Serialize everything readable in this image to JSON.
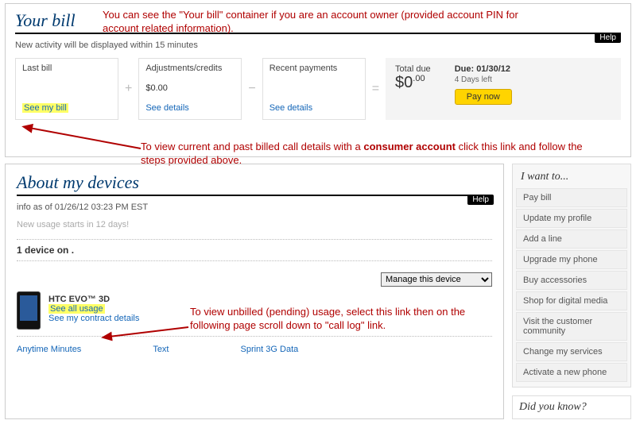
{
  "yourBill": {
    "title": "Your bill",
    "help": "Help",
    "newActivity": "New activity will be displayed within 15 minutes",
    "lastBill": {
      "label": "Last bill",
      "seeMyBill": "See my bill"
    },
    "adjustments": {
      "label": "Adjustments/credits",
      "amount": "$0.00",
      "seeDetails": "See details"
    },
    "recentPayments": {
      "label": "Recent payments",
      "seeDetails": "See details"
    },
    "totalDue": {
      "label": "Total due",
      "amount": "$0",
      "cents": ".00",
      "dueLabel": "Due: 01/30/12",
      "daysLeft": "4 Days left",
      "payNow": "Pay now"
    }
  },
  "annot": {
    "top": "You can see the \"Your bill\" container if you are an account owner (provided account PIN for account related information).",
    "mid1": "To view current and past billed call details with a ",
    "mid2": "consumer account",
    "mid3": " click this link and follow the steps provided above.",
    "bottom": "To view unbilled (pending) usage, select this link then on the following page scroll down to \"call log\" link."
  },
  "aboutDevices": {
    "title": "About my devices",
    "help": "Help",
    "infoAsOf": "info as of 01/26/12 03:23 PM EST",
    "newUsage": "New usage starts in 12 days!",
    "deviceCount": "1 device on .",
    "manageOption": "Manage this device",
    "device": {
      "name": "HTC EVO™ 3D",
      "seeAllUsage": "See all usage",
      "seeContract": "See my contract details"
    },
    "usageTabs": {
      "anytime": "Anytime Minutes",
      "text": "Text",
      "data": "Sprint 3G Data"
    }
  },
  "iWant": {
    "title": "I want to...",
    "items": [
      "Pay bill",
      "Update my profile",
      "Add a line",
      "Upgrade my phone",
      "Buy accessories",
      "Shop for digital media",
      "Visit the customer community",
      "Change my services",
      "Activate a new phone"
    ]
  },
  "didYouKnow": {
    "title": "Did you know?"
  }
}
